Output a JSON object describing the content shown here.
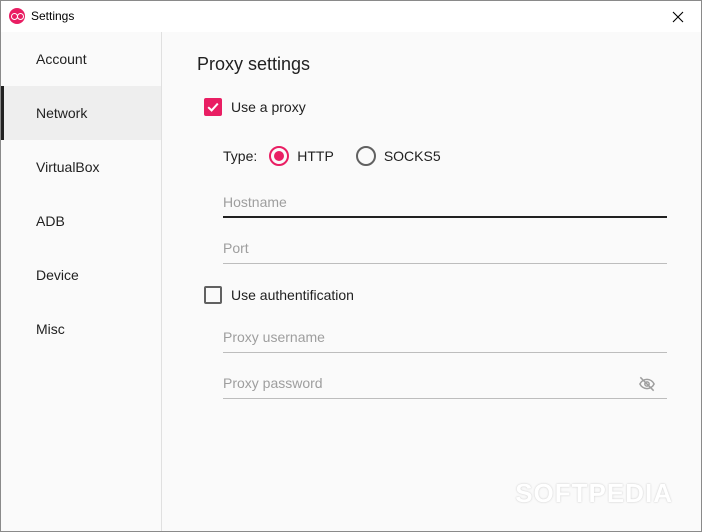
{
  "window": {
    "title": "Settings"
  },
  "sidebar": {
    "items": [
      {
        "label": "Account",
        "active": false
      },
      {
        "label": "Network",
        "active": true
      },
      {
        "label": "VirtualBox",
        "active": false
      },
      {
        "label": "ADB",
        "active": false
      },
      {
        "label": "Device",
        "active": false
      },
      {
        "label": "Misc",
        "active": false
      }
    ]
  },
  "proxy": {
    "title": "Proxy settings",
    "use_proxy_label": "Use a proxy",
    "use_proxy_checked": true,
    "type_label": "Type:",
    "types": [
      {
        "label": "HTTP",
        "selected": true
      },
      {
        "label": "SOCKS5",
        "selected": false
      }
    ],
    "hostname": {
      "placeholder": "Hostname",
      "value": ""
    },
    "port": {
      "placeholder": "Port",
      "value": ""
    },
    "auth_label": "Use authentification",
    "auth_checked": false,
    "username": {
      "placeholder": "Proxy username",
      "value": ""
    },
    "password": {
      "placeholder": "Proxy password",
      "value": ""
    }
  },
  "colors": {
    "accent": "#e91e63"
  },
  "watermark": "SOFTPEDIA"
}
